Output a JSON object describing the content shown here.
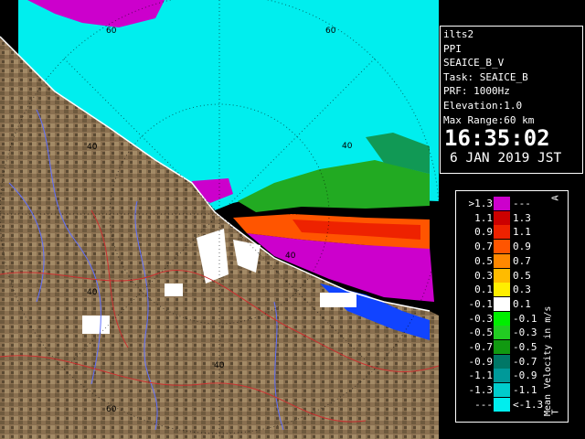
{
  "info": {
    "lines": [
      "ilts2",
      "PPI",
      "SEAICE_B_V",
      "Task: SEAICE_B",
      "PRF: 1000Hz",
      "Elevation:1.0",
      "Max Range:60 km"
    ],
    "time": "16:35:02",
    "date": "6 JAN 2019 JST"
  },
  "legend": {
    "title": "Mean Velocity in m/s",
    "left_labels": [
      ">1.3",
      "1.1",
      "0.9",
      "0.7",
      "0.5",
      "0.3",
      "0.1",
      "-0.1",
      "-0.3",
      "-0.5",
      "-0.7",
      "-0.9",
      "-1.1",
      "-1.3",
      "---"
    ],
    "right_labels": [
      "---",
      "1.3",
      "1.1",
      "0.9",
      "0.7",
      "0.5",
      "0.3",
      "0.1",
      "-0.1",
      "-0.3",
      "-0.5",
      "-0.7",
      "-0.9",
      "-1.1",
      "<-1.3"
    ],
    "colors": [
      "#cc00cc",
      "#cc0000",
      "#ee2200",
      "#ff5500",
      "#ff8800",
      "#ffbb00",
      "#ffee00",
      "#ffffff",
      "#00ee00",
      "#22cc22",
      "#119911",
      "#007766",
      "#009999",
      "#00cccc",
      "#00eeee"
    ],
    "top_mark": "A",
    "bottom_mark": "T"
  },
  "map": {
    "range_labels": [
      "60",
      "40",
      "40",
      "40",
      "40",
      "40",
      "60",
      "60"
    ],
    "colors": {
      "sea_ice": "#00eeee",
      "land": "#8a7050",
      "land_dark": "#5a4630",
      "approaching": "#cc00cc",
      "receding_orange": "#ff5500",
      "white": "#ffffff",
      "green": "#22aa22",
      "blue": "#1144ff"
    }
  }
}
